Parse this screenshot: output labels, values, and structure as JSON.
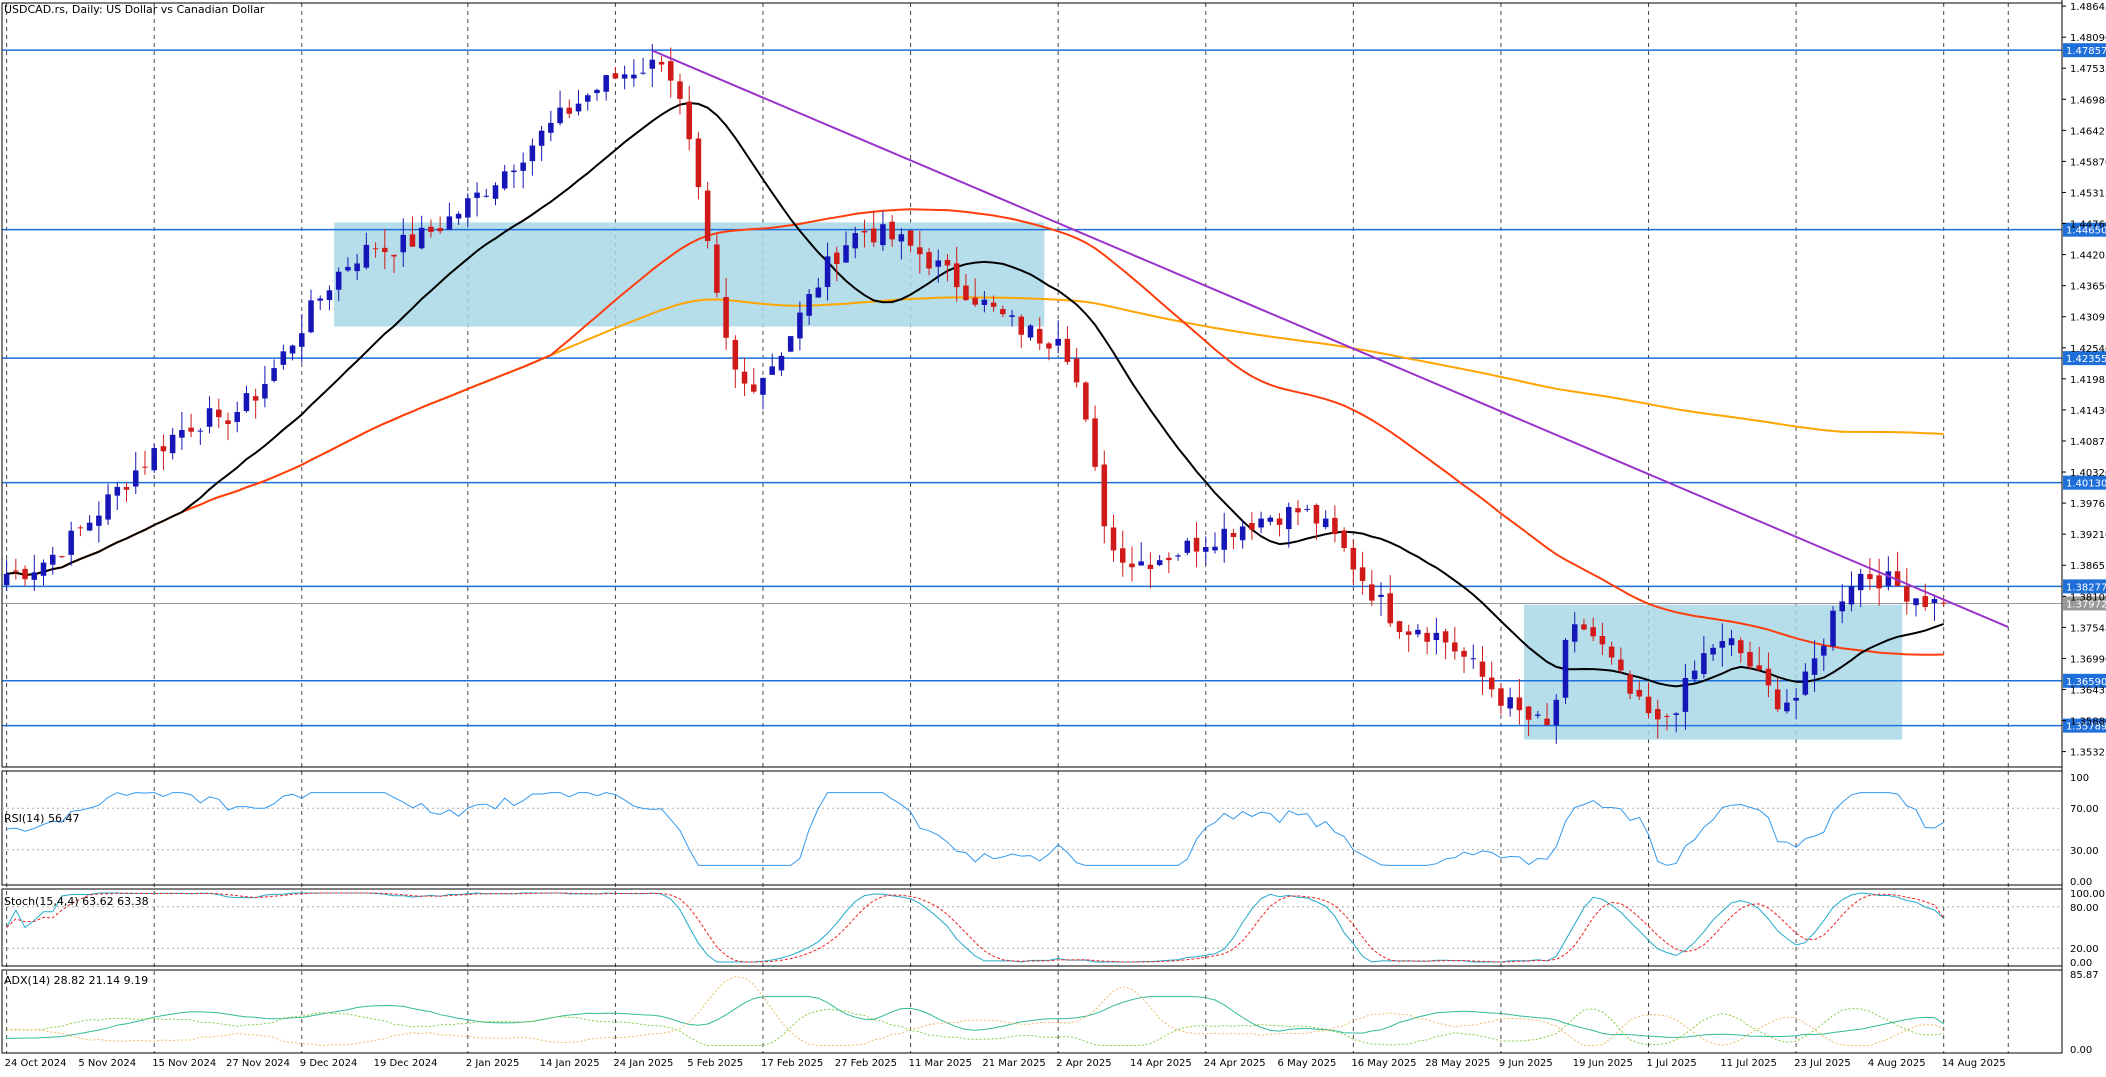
{
  "header": {
    "title": "USDCAD.rs, Daily: US Dollar vs Canadian Dollar"
  },
  "panes": {
    "rsi_label": "RSI(14) 56.47",
    "stoch_label": "Stoch(15,4,4) 63.62 63.38",
    "adx_label": "ADX(14) 28.82 21.14 9.19"
  },
  "price_axis_ticks": [
    "1.48645",
    "1.48090",
    "1.47535",
    "1.46980",
    "1.46425",
    "1.45870",
    "1.45315",
    "1.44760",
    "1.44205",
    "1.43650",
    "1.43095",
    "1.42540",
    "1.41985",
    "1.41430",
    "1.40875",
    "1.40320",
    "1.39765",
    "1.39210",
    "1.38655",
    "1.38100",
    "1.37545",
    "1.36990",
    "1.36435",
    "1.35880",
    "1.35325"
  ],
  "rsi_axis_ticks": [
    "100",
    "70.00",
    "30.00",
    "0.00"
  ],
  "stoch_axis_ticks": [
    "100.00",
    "80.00",
    "20.00",
    "0.00"
  ],
  "adx_axis_ticks": [
    "85.87",
    "0.00"
  ],
  "date_ticks": [
    "24 Oct 2024",
    "5 Nov 2024",
    "15 Nov 2024",
    "27 Nov 2024",
    "9 Dec 2024",
    "19 Dec 2024",
    "2 Jan 2025",
    "14 Jan 2025",
    "24 Jan 2025",
    "5 Feb 2025",
    "17 Feb 2025",
    "27 Feb 2025",
    "11 Mar 2025",
    "21 Mar 2025",
    "2 Apr 2025",
    "14 Apr 2025",
    "24 Apr 2025",
    "6 May 2025",
    "16 May 2025",
    "28 May 2025",
    "9 Jun 2025",
    "19 Jun 2025",
    "1 Jul 2025",
    "11 Jul 2025",
    "23 Jul 2025",
    "4 Aug 2025",
    "14 Aug 2025"
  ],
  "colors": {
    "bull": "#1616b8",
    "bear": "#d01a1a",
    "hline": "#1e6fd9",
    "trendline": "#9933cc",
    "ma_fast": "#000000",
    "ma_mid": "#ff3d0d",
    "ma_slow": "#ffa500",
    "zone": "#a8d8e6",
    "rsi": "#3399ee",
    "stoch_main": "#22aacc",
    "stoch_signal": "#ee2222",
    "adx_main": "#33bb99",
    "adx_plus": "#88cc44",
    "adx_minus": "#eebb66",
    "price_tag_text": "#ffffff"
  },
  "chart_data": {
    "type": "candlestick",
    "title": "USDCAD.rs, Daily: US Dollar vs Canadian Dollar",
    "ylim": [
      1.3505,
      1.487
    ],
    "grid": true,
    "grid_style": "vertical dashed",
    "horizontal_levels": [
      {
        "value": 1.47857,
        "label": "1.47857"
      },
      {
        "value": 1.4465,
        "label": "1.44650"
      },
      {
        "value": 1.42355,
        "label": "1.42355"
      },
      {
        "value": 1.4013,
        "label": "1.40130"
      },
      {
        "value": 1.38277,
        "label": "1.38277"
      },
      {
        "value": 1.3659,
        "label": "1.36590"
      },
      {
        "value": 1.35789,
        "label": "1.35789"
      }
    ],
    "current_price": {
      "value": 1.37972,
      "label": "1.37972"
    },
    "trendline": {
      "from": {
        "date": "2025-01-30",
        "price": 1.4785
      },
      "to": {
        "date": "2025-08-25",
        "price": 1.3755
      }
    },
    "zones": [
      {
        "from": "2024-12-13",
        "to": "2025-03-31",
        "low": 1.4292,
        "high": 1.4478
      },
      {
        "from": "2025-06-12",
        "to": "2025-08-07",
        "low": 1.3554,
        "high": 1.3795
      }
    ],
    "key_points": [
      {
        "date": "2024-10-24",
        "close": 1.385
      },
      {
        "date": "2024-11-26",
        "close": 1.413
      },
      {
        "date": "2024-12-19",
        "close": 1.443
      },
      {
        "date": "2025-01-31",
        "close": 1.476
      },
      {
        "date": "2025-02-13",
        "close": 1.419
      },
      {
        "date": "2025-03-04",
        "close": 1.446
      },
      {
        "date": "2025-04-02",
        "close": 1.427
      },
      {
        "date": "2025-04-11",
        "close": 1.387
      },
      {
        "date": "2025-05-08",
        "close": 1.396
      },
      {
        "date": "2025-05-27",
        "close": 1.375
      },
      {
        "date": "2025-06-16",
        "close": 1.358
      },
      {
        "date": "2025-06-19",
        "close": 1.376
      },
      {
        "date": "2025-07-02",
        "close": 1.359
      },
      {
        "date": "2025-07-11",
        "close": 1.373
      },
      {
        "date": "2025-07-22",
        "close": 1.362
      },
      {
        "date": "2025-08-01",
        "close": 1.385
      },
      {
        "date": "2025-08-14",
        "close": 1.3797
      }
    ],
    "moving_averages": [
      {
        "role": "fast",
        "color": "#000000"
      },
      {
        "role": "medium",
        "color": "#ff3d0d"
      },
      {
        "role": "slow",
        "color": "#ffa500"
      }
    ],
    "indicators": {
      "rsi": {
        "period": 14,
        "last": 56.47,
        "levels": [
          70,
          30
        ],
        "range": [
          0,
          100
        ]
      },
      "stochastic": {
        "params": [
          15,
          4,
          4
        ],
        "main": 63.62,
        "signal": 63.38,
        "levels": [
          80,
          20
        ],
        "range": [
          0,
          100
        ]
      },
      "adx": {
        "period": 14,
        "adx": 28.82,
        "plus_di": 21.14,
        "minus_di": 9.19,
        "range": [
          0,
          85.87
        ]
      }
    }
  }
}
